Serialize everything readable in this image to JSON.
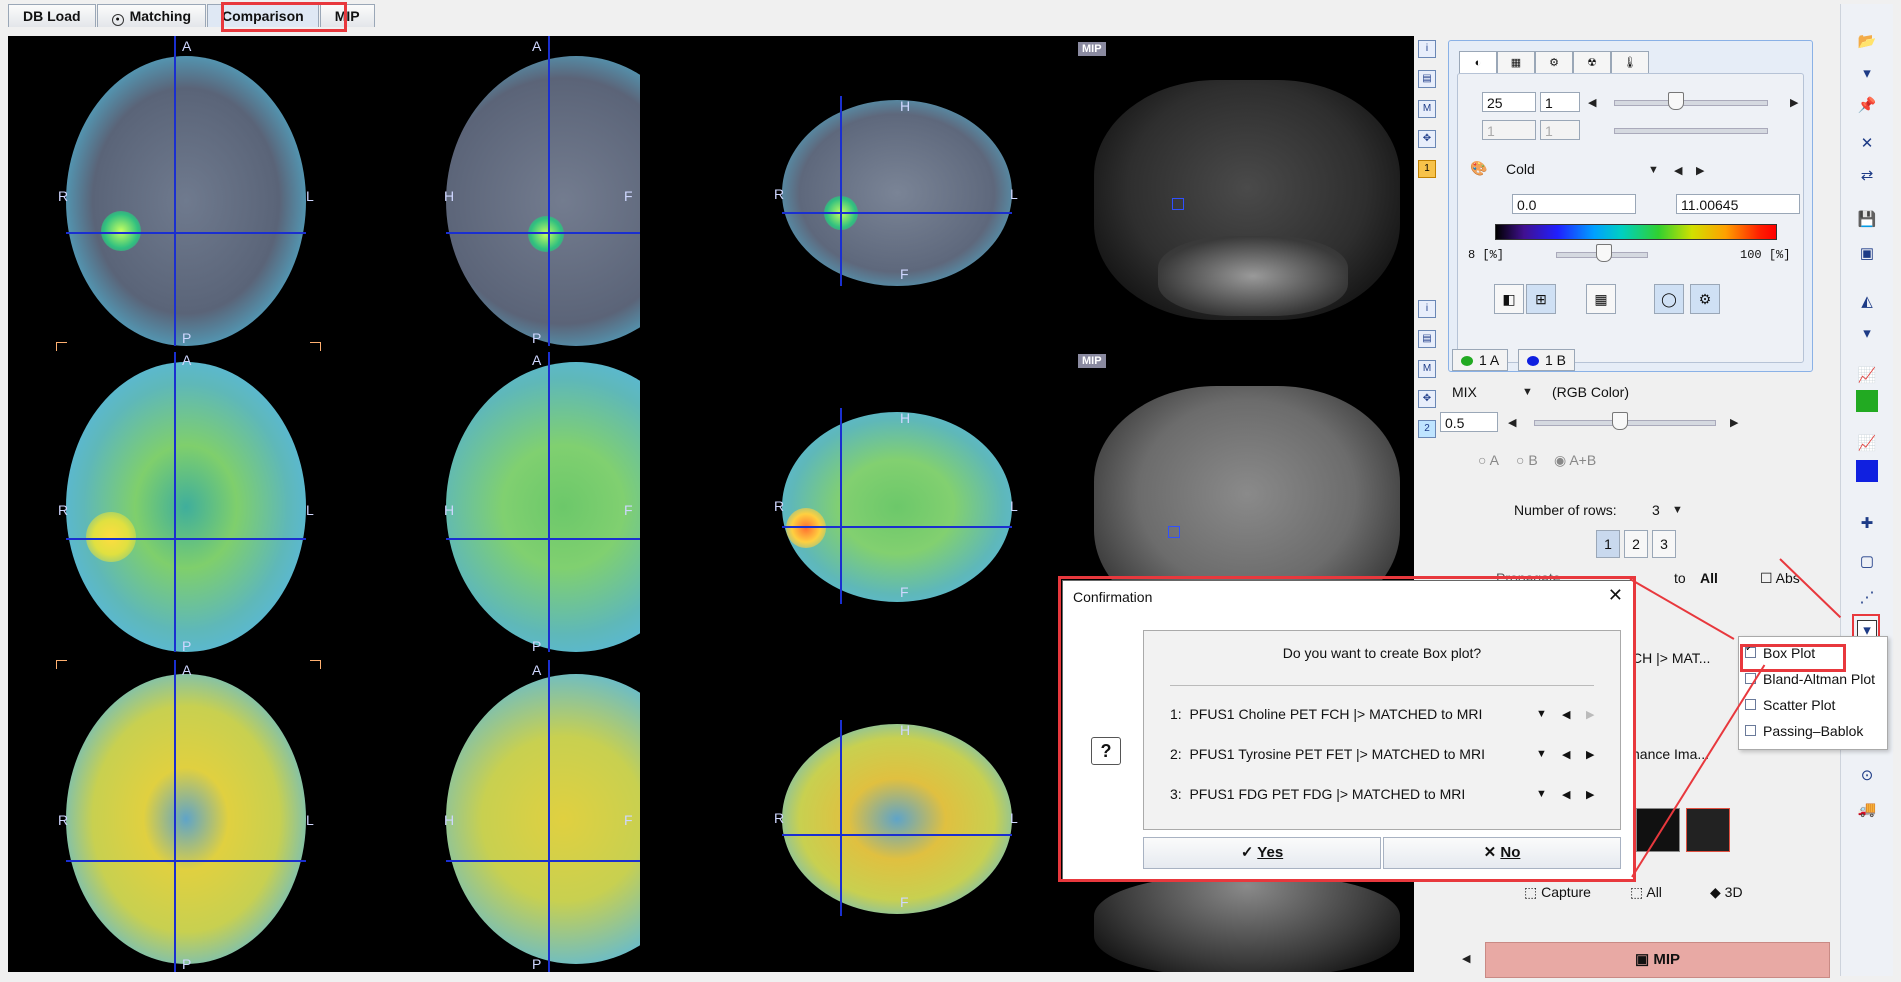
{
  "tabs": [
    {
      "label": "DB Load"
    },
    {
      "label": "Matching"
    },
    {
      "label": "Comparison"
    },
    {
      "label": "MIP"
    }
  ],
  "orientation": {
    "a": "A",
    "p": "P",
    "r": "R",
    "l": "L",
    "h": "H",
    "f": "F"
  },
  "mip_tag": "MIP",
  "panel": {
    "slice_value": "25",
    "slice_step": "1",
    "slice2_value": "1",
    "slice2_step": "1",
    "colormap": "Cold",
    "min_value": "0.0",
    "max_value": "11.00645",
    "range_low": "8",
    "range_high": "100",
    "range_unit": "[%]",
    "series_tabs": [
      "1 A",
      "1 B"
    ],
    "mix_mode": "MIX",
    "mix_color": "(RGB Color)",
    "mix_value": "0.5",
    "radio_a": "A",
    "radio_b": "B",
    "radio_ab": "A+B",
    "rows_label": "Number of rows:",
    "rows_value": "3",
    "row_buttons": [
      "1",
      "2",
      "3"
    ],
    "propagate_label": "Propagate",
    "to_label": "to",
    "to_value": "All",
    "abs_label": "Abs",
    "series_short_1": "CH |> MAT...",
    "series_short_2": "nance Ima...",
    "capture": "Capture",
    "all": "All",
    "three_d": "3D",
    "mip_button": "MIP",
    "side_num_1": "1",
    "side_num_2": "2"
  },
  "menu": {
    "items": [
      {
        "label": "Box Plot",
        "checked": true
      },
      {
        "label": "Bland-Altman Plot",
        "checked": false
      },
      {
        "label": "Scatter Plot",
        "checked": false
      },
      {
        "label": "Passing–Bablok",
        "checked": false
      }
    ]
  },
  "dialog": {
    "title": "Confirmation",
    "question": "Do you want to create Box plot?",
    "rows": [
      {
        "num": "1:",
        "label": "PFUS1 Choline PET FCH |> MATCHED to MRI"
      },
      {
        "num": "2:",
        "label": "PFUS1 Tyrosine PET FET |> MATCHED to MRI"
      },
      {
        "num": "3:",
        "label": "PFUS1 FDG PET FDG |> MATCHED to MRI"
      }
    ],
    "yes": "Yes",
    "no": "No",
    "help": "?"
  },
  "colors": {
    "highlight": "#e8383d",
    "crosshair": "#1a2fd0",
    "mip_button": "#e8a9a4"
  }
}
